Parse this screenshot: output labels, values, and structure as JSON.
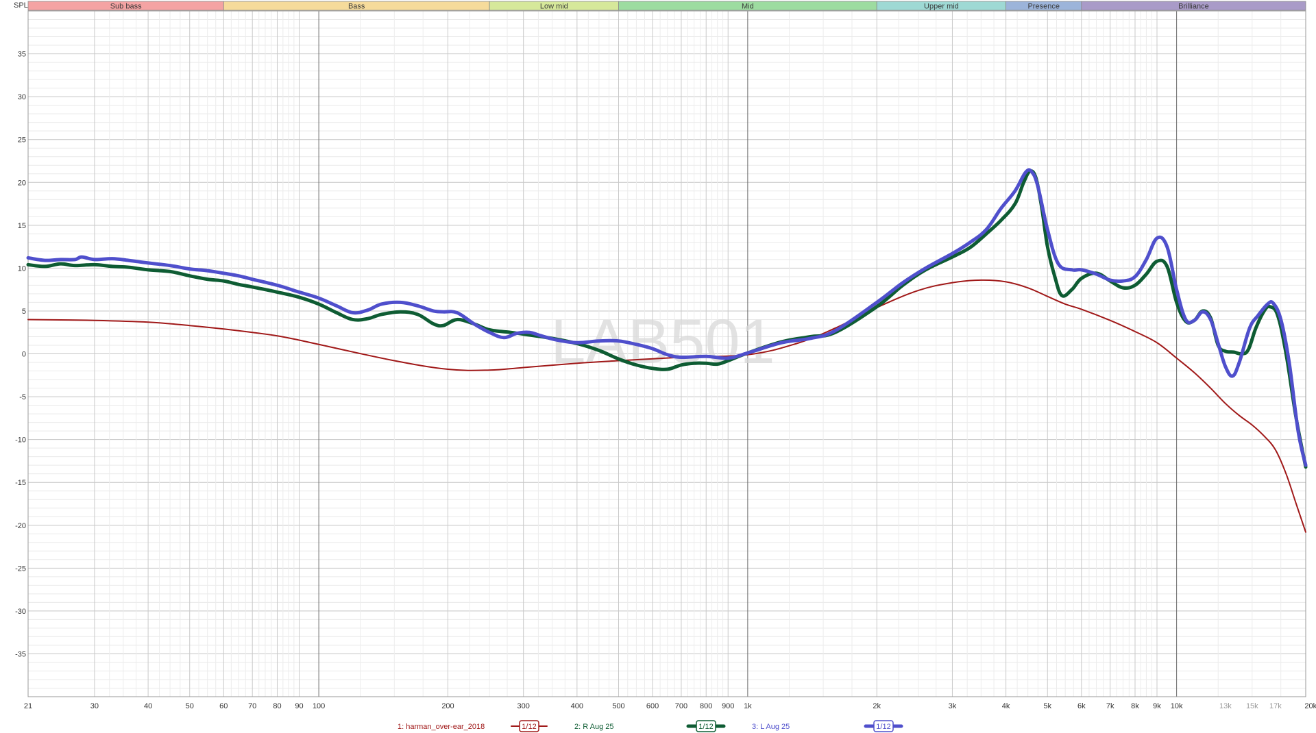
{
  "chart_data": {
    "type": "line",
    "ylabel": "SPL",
    "x_unit": "Hz",
    "x_scale": "log",
    "xlim": [
      21,
      20000
    ],
    "ylim": [
      -40,
      40
    ],
    "grid": true,
    "watermark": "LAB501",
    "bands": [
      {
        "label": "Sub bass",
        "from": 21,
        "to": 60,
        "color": "#f4a3a3"
      },
      {
        "label": "Bass",
        "from": 60,
        "to": 250,
        "color": "#f6db9b"
      },
      {
        "label": "Low mid",
        "from": 250,
        "to": 500,
        "color": "#d6e89a"
      },
      {
        "label": "Mid",
        "from": 500,
        "to": 2000,
        "color": "#9ddca0"
      },
      {
        "label": "Upper mid",
        "from": 2000,
        "to": 4000,
        "color": "#9ed9d4"
      },
      {
        "label": "Presence",
        "from": 4000,
        "to": 6000,
        "color": "#9cb4da"
      },
      {
        "label": "Brilliance",
        "from": 6000,
        "to": 20000,
        "color": "#a99bc8"
      }
    ],
    "y_ticks": [
      {
        "value": 35,
        "label": "35"
      },
      {
        "value": 30,
        "label": "30"
      },
      {
        "value": 25,
        "label": "25"
      },
      {
        "value": 20,
        "label": "20"
      },
      {
        "value": 15,
        "label": "15"
      },
      {
        "value": 10,
        "label": "10"
      },
      {
        "value": 5,
        "label": "5"
      },
      {
        "value": 0,
        "label": "0"
      },
      {
        "value": -5,
        "label": "-5"
      },
      {
        "value": -10,
        "label": "-10"
      },
      {
        "value": -15,
        "label": "-15"
      },
      {
        "value": -20,
        "label": "-20"
      },
      {
        "value": -25,
        "label": "-25"
      },
      {
        "value": -30,
        "label": "-30"
      },
      {
        "value": -35,
        "label": "-35"
      }
    ],
    "x_ticks": [
      {
        "value": 21,
        "label": "21"
      },
      {
        "value": 30,
        "label": "30"
      },
      {
        "value": 40,
        "label": "40"
      },
      {
        "value": 50,
        "label": "50"
      },
      {
        "value": 60,
        "label": "60"
      },
      {
        "value": 70,
        "label": "70"
      },
      {
        "value": 80,
        "label": "80"
      },
      {
        "value": 90,
        "label": "90"
      },
      {
        "value": 100,
        "label": "100"
      },
      {
        "value": 200,
        "label": "200"
      },
      {
        "value": 300,
        "label": "300"
      },
      {
        "value": 400,
        "label": "400"
      },
      {
        "value": 500,
        "label": "500"
      },
      {
        "value": 600,
        "label": "600"
      },
      {
        "value": 700,
        "label": "700"
      },
      {
        "value": 800,
        "label": "800"
      },
      {
        "value": 900,
        "label": "900"
      },
      {
        "value": 1000,
        "label": "1k"
      },
      {
        "value": 2000,
        "label": "2k"
      },
      {
        "value": 3000,
        "label": "3k"
      },
      {
        "value": 4000,
        "label": "4k"
      },
      {
        "value": 5000,
        "label": "5k"
      },
      {
        "value": 6000,
        "label": "6k"
      },
      {
        "value": 7000,
        "label": "7k"
      },
      {
        "value": 8000,
        "label": "8k"
      },
      {
        "value": 9000,
        "label": "9k"
      },
      {
        "value": 10000,
        "label": "10k"
      },
      {
        "value": 13000,
        "label": "13k",
        "faint": true
      },
      {
        "value": 15000,
        "label": "15k",
        "faint": true
      },
      {
        "value": 17000,
        "label": "17k",
        "faint": true
      },
      {
        "value": 20000,
        "label": "20kHz"
      }
    ],
    "series": [
      {
        "name": "1: harman_over-ear_2018",
        "smoothing": "1/12",
        "color": "#a01818",
        "width": 2,
        "points": [
          [
            21,
            4.0
          ],
          [
            30,
            3.9
          ],
          [
            40,
            3.7
          ],
          [
            50,
            3.3
          ],
          [
            60,
            2.9
          ],
          [
            70,
            2.5
          ],
          [
            80,
            2.1
          ],
          [
            90,
            1.6
          ],
          [
            100,
            1.1
          ],
          [
            150,
            -0.8
          ],
          [
            200,
            -1.8
          ],
          [
            250,
            -1.9
          ],
          [
            300,
            -1.6
          ],
          [
            400,
            -1.1
          ],
          [
            500,
            -0.8
          ],
          [
            700,
            -0.4
          ],
          [
            1000,
            -0.1
          ],
          [
            1300,
            1.2
          ],
          [
            1600,
            3.0
          ],
          [
            2000,
            5.4
          ],
          [
            2500,
            7.4
          ],
          [
            3000,
            8.3
          ],
          [
            3500,
            8.6
          ],
          [
            4000,
            8.4
          ],
          [
            4500,
            7.7
          ],
          [
            5000,
            6.7
          ],
          [
            5500,
            5.8
          ],
          [
            6000,
            5.2
          ],
          [
            7000,
            3.9
          ],
          [
            8000,
            2.6
          ],
          [
            9000,
            1.3
          ],
          [
            10000,
            -0.5
          ],
          [
            11000,
            -2.2
          ],
          [
            12000,
            -4.0
          ],
          [
            13000,
            -5.8
          ],
          [
            14000,
            -7.2
          ],
          [
            15000,
            -8.3
          ],
          [
            16000,
            -9.6
          ],
          [
            17000,
            -11.2
          ],
          [
            18000,
            -14.0
          ],
          [
            19000,
            -17.5
          ],
          [
            20000,
            -20.8
          ]
        ]
      },
      {
        "name": "2: R Aug 25",
        "smoothing": "1/12",
        "color": "#0e5c33",
        "width": 5,
        "points": [
          [
            21,
            10.4
          ],
          [
            23,
            10.2
          ],
          [
            25,
            10.5
          ],
          [
            27,
            10.3
          ],
          [
            30,
            10.4
          ],
          [
            33,
            10.2
          ],
          [
            36,
            10.1
          ],
          [
            40,
            9.8
          ],
          [
            45,
            9.6
          ],
          [
            50,
            9.1
          ],
          [
            55,
            8.7
          ],
          [
            60,
            8.5
          ],
          [
            65,
            8.1
          ],
          [
            70,
            7.8
          ],
          [
            80,
            7.2
          ],
          [
            90,
            6.6
          ],
          [
            100,
            5.8
          ],
          [
            110,
            4.8
          ],
          [
            120,
            4.0
          ],
          [
            130,
            4.1
          ],
          [
            140,
            4.6
          ],
          [
            155,
            4.9
          ],
          [
            170,
            4.6
          ],
          [
            185,
            3.5
          ],
          [
            195,
            3.3
          ],
          [
            210,
            4.0
          ],
          [
            230,
            3.5
          ],
          [
            250,
            2.8
          ],
          [
            280,
            2.5
          ],
          [
            300,
            2.3
          ],
          [
            350,
            1.8
          ],
          [
            400,
            1.2
          ],
          [
            450,
            0.4
          ],
          [
            500,
            -0.6
          ],
          [
            550,
            -1.3
          ],
          [
            600,
            -1.7
          ],
          [
            650,
            -1.8
          ],
          [
            700,
            -1.3
          ],
          [
            750,
            -1.1
          ],
          [
            800,
            -1.1
          ],
          [
            850,
            -1.2
          ],
          [
            900,
            -0.8
          ],
          [
            1000,
            0.1
          ],
          [
            1200,
            1.4
          ],
          [
            1400,
            2.0
          ],
          [
            1600,
            2.5
          ],
          [
            2000,
            5.5
          ],
          [
            2300,
            8.0
          ],
          [
            2600,
            9.8
          ],
          [
            3000,
            11.3
          ],
          [
            3300,
            12.4
          ],
          [
            3600,
            14.0
          ],
          [
            3900,
            15.6
          ],
          [
            4200,
            17.5
          ],
          [
            4400,
            20.0
          ],
          [
            4550,
            21.3
          ],
          [
            4700,
            20.5
          ],
          [
            4850,
            17.0
          ],
          [
            5000,
            12.5
          ],
          [
            5200,
            9.0
          ],
          [
            5400,
            6.8
          ],
          [
            5700,
            7.5
          ],
          [
            6000,
            8.8
          ],
          [
            6500,
            9.4
          ],
          [
            7000,
            8.5
          ],
          [
            7500,
            7.7
          ],
          [
            8000,
            8.0
          ],
          [
            8500,
            9.3
          ],
          [
            9000,
            10.8
          ],
          [
            9500,
            10.2
          ],
          [
            10000,
            6.0
          ],
          [
            10500,
            3.8
          ],
          [
            11000,
            3.9
          ],
          [
            11500,
            5.0
          ],
          [
            12000,
            4.2
          ],
          [
            12500,
            1.0
          ],
          [
            13000,
            0.3
          ],
          [
            13600,
            0.2
          ],
          [
            14200,
            0.0
          ],
          [
            14700,
            0.5
          ],
          [
            15300,
            3.0
          ],
          [
            16000,
            5.0
          ],
          [
            16500,
            5.5
          ],
          [
            17200,
            4.5
          ],
          [
            18000,
            0.0
          ],
          [
            19000,
            -7.5
          ],
          [
            20000,
            -13.2
          ]
        ]
      },
      {
        "name": "3: L Aug 25",
        "smoothing": "1/12",
        "color": "#4f4fcc",
        "width": 5,
        "points": [
          [
            21,
            11.2
          ],
          [
            23,
            10.9
          ],
          [
            25,
            11.0
          ],
          [
            27,
            11.0
          ],
          [
            28,
            11.3
          ],
          [
            30,
            11.0
          ],
          [
            33,
            11.1
          ],
          [
            36,
            10.9
          ],
          [
            40,
            10.6
          ],
          [
            45,
            10.3
          ],
          [
            50,
            9.9
          ],
          [
            55,
            9.7
          ],
          [
            60,
            9.4
          ],
          [
            65,
            9.1
          ],
          [
            70,
            8.7
          ],
          [
            80,
            8.0
          ],
          [
            90,
            7.2
          ],
          [
            100,
            6.5
          ],
          [
            110,
            5.6
          ],
          [
            120,
            4.8
          ],
          [
            130,
            5.1
          ],
          [
            140,
            5.8
          ],
          [
            155,
            6.0
          ],
          [
            170,
            5.6
          ],
          [
            185,
            5.0
          ],
          [
            195,
            4.9
          ],
          [
            210,
            4.8
          ],
          [
            230,
            3.5
          ],
          [
            250,
            2.5
          ],
          [
            270,
            1.9
          ],
          [
            290,
            2.4
          ],
          [
            310,
            2.5
          ],
          [
            330,
            2.1
          ],
          [
            360,
            1.6
          ],
          [
            400,
            1.3
          ],
          [
            450,
            1.5
          ],
          [
            500,
            1.5
          ],
          [
            550,
            1.1
          ],
          [
            600,
            0.6
          ],
          [
            650,
            -0.1
          ],
          [
            700,
            -0.4
          ],
          [
            800,
            -0.3
          ],
          [
            900,
            -0.5
          ],
          [
            1000,
            0.1
          ],
          [
            1200,
            1.3
          ],
          [
            1400,
            1.8
          ],
          [
            1600,
            2.7
          ],
          [
            2000,
            6.0
          ],
          [
            2300,
            8.3
          ],
          [
            2600,
            10.0
          ],
          [
            3000,
            11.7
          ],
          [
            3300,
            13.0
          ],
          [
            3600,
            14.5
          ],
          [
            3900,
            17.0
          ],
          [
            4200,
            19.0
          ],
          [
            4450,
            21.2
          ],
          [
            4600,
            21.2
          ],
          [
            4750,
            19.5
          ],
          [
            5000,
            14.5
          ],
          [
            5300,
            10.5
          ],
          [
            5700,
            9.8
          ],
          [
            6000,
            9.8
          ],
          [
            6500,
            9.3
          ],
          [
            7000,
            8.6
          ],
          [
            7500,
            8.5
          ],
          [
            8000,
            9.0
          ],
          [
            8500,
            11.0
          ],
          [
            9000,
            13.5
          ],
          [
            9500,
            12.5
          ],
          [
            10000,
            7.5
          ],
          [
            10500,
            4.0
          ],
          [
            11000,
            3.9
          ],
          [
            11500,
            4.9
          ],
          [
            12000,
            4.0
          ],
          [
            12500,
            1.2
          ],
          [
            13000,
            -1.5
          ],
          [
            13500,
            -2.6
          ],
          [
            14000,
            -1.0
          ],
          [
            14800,
            3.0
          ],
          [
            15500,
            4.5
          ],
          [
            16300,
            5.8
          ],
          [
            16800,
            5.9
          ],
          [
            17500,
            4.0
          ],
          [
            18300,
            -1.0
          ],
          [
            19200,
            -9.0
          ],
          [
            20000,
            -13.0
          ]
        ]
      }
    ]
  }
}
